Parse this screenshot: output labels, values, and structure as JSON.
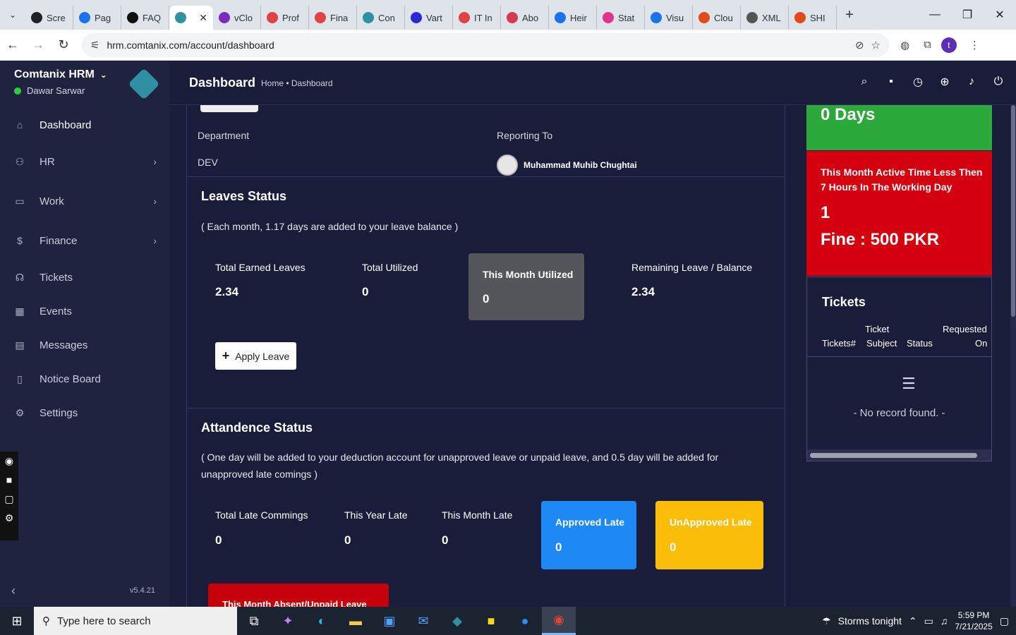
{
  "browser": {
    "tabs": [
      {
        "title": "Scre",
        "color": "#202124"
      },
      {
        "title": "Pag",
        "color": "#1a73e8"
      },
      {
        "title": "FAQ",
        "color": "#111"
      },
      {
        "title": "",
        "color": "#2f8fa3",
        "active": true
      },
      {
        "title": "vClo",
        "color": "#7b2cbf"
      },
      {
        "title": "Prof",
        "color": "#e04343"
      },
      {
        "title": "Fina",
        "color": "#e04343"
      },
      {
        "title": "Con",
        "color": "#2f8fa3"
      },
      {
        "title": "Vart",
        "color": "#2a2ad4"
      },
      {
        "title": "IT In",
        "color": "#e04343"
      },
      {
        "title": "Abo",
        "color": "#d43a52"
      },
      {
        "title": "Heir",
        "color": "#1a73e8"
      },
      {
        "title": "Stat",
        "color": "#e0358b"
      },
      {
        "title": "Visu",
        "color": "#1a73e8"
      },
      {
        "title": "Clou",
        "color": "#e24a1a"
      },
      {
        "title": "XML",
        "color": "#555"
      },
      {
        "title": "SHI",
        "color": "#e24a1a"
      }
    ],
    "url": "hrm.comtanix.com/account/dashboard",
    "profile_initial": "t"
  },
  "sidebar": {
    "brand": "Comtanix HRM",
    "user": "Dawar Sarwar",
    "items": [
      {
        "label": "Dashboard",
        "icon": "home-icon",
        "glyph": "⌂",
        "arrow": ""
      },
      {
        "label": "HR",
        "icon": "users-icon",
        "glyph": "⚇",
        "arrow": "›"
      },
      {
        "label": "Work",
        "icon": "briefcase-icon",
        "glyph": "▭",
        "arrow": "›"
      },
      {
        "label": "Finance",
        "icon": "dollar-icon",
        "glyph": "$",
        "arrow": "›"
      },
      {
        "label": "Tickets",
        "icon": "headset-icon",
        "glyph": "☊",
        "arrow": ""
      },
      {
        "label": "Events",
        "icon": "calendar-icon",
        "glyph": "▦",
        "arrow": ""
      },
      {
        "label": "Messages",
        "icon": "message-icon",
        "glyph": "▤",
        "arrow": ""
      },
      {
        "label": "Notice Board",
        "icon": "clipboard-icon",
        "glyph": "▯",
        "arrow": ""
      },
      {
        "label": "Settings",
        "icon": "gear-icon",
        "glyph": "⚙",
        "arrow": ""
      }
    ],
    "version": "v5.4.21"
  },
  "header": {
    "title": "Dashboard",
    "breadcrumb": "Home • Dashboard"
  },
  "profile": {
    "department_label": "Department",
    "department_value": "DEV",
    "reporting_label": "Reporting To",
    "reporting_value": "Muhammad Muhib Chughtai"
  },
  "leaves": {
    "title": "Leaves Status",
    "note": "( Each month, 1.17 days are added to your leave balance )",
    "earned_label": "Total Earned Leaves",
    "earned_value": "2.34",
    "utilized_label": "Total Utilized",
    "utilized_value": "0",
    "month_label": "This Month Utilized",
    "month_value": "0",
    "remaining_label": "Remaining Leave / Balance",
    "remaining_value": "2.34",
    "apply_button": "Apply Leave"
  },
  "attendance": {
    "title": "Attandence Status",
    "note_line1": "( One day will be added to your deduction account for unapproved leave or unpaid leave, and 0.5 day will be added for",
    "note_line2": "unapproved late comings )",
    "total_late_label": "Total Late Commings",
    "total_late_value": "0",
    "year_late_label": "This Year Late",
    "year_late_value": "0",
    "month_late_label": "This Month Late",
    "month_late_value": "0",
    "approved_label": "Approved Late",
    "approved_value": "0",
    "unapproved_label": "UnApproved Late",
    "unapproved_value": "0",
    "absent_label": "This Month Absent/Unpaid Leave"
  },
  "right": {
    "days_value": "0 Days",
    "active_time_label": "This Month Active Time Less Then 7 Hours In The Working Day",
    "active_time_count": "1",
    "fine": "Fine : 500 PKR",
    "tickets_title": "Tickets",
    "col_ticket_no": "Tickets#",
    "col_subject_1": "Ticket",
    "col_subject_2": "Subject",
    "col_status": "Status",
    "col_requested_1": "Requested",
    "col_requested_2": "On",
    "no_record": "- No record found. -"
  },
  "colors": {
    "green": "#2da83a",
    "red": "#d40010",
    "blue": "#1e88f5",
    "yellow": "#fbbd08",
    "gray_card": "#55565b"
  },
  "taskbar": {
    "search_placeholder": "Type here to search",
    "weather": "Storms tonight",
    "time": "5:59 PM",
    "date": "7/21/2025"
  }
}
